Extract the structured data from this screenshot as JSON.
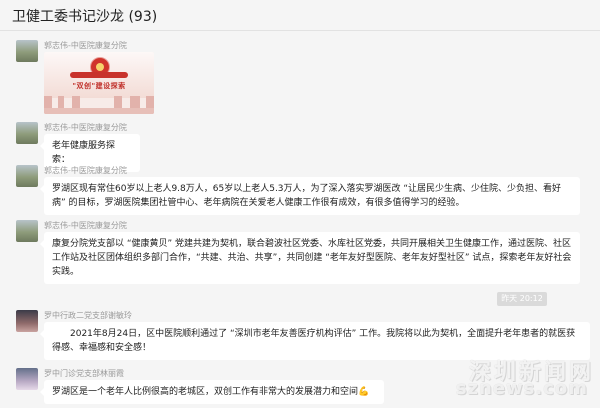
{
  "chat": {
    "title": "卫健工委书记沙龙 (93)"
  },
  "messages": [
    {
      "sender": "郭志伟-中医院康复分院",
      "image_caption": "\"双创\"建设探索"
    },
    {
      "sender": "郭志伟-中医院康复分院",
      "text": "老年健康服务探索："
    },
    {
      "sender": "郭志伟-中医院康复分院",
      "text": "罗湖区现有常住60岁以上老人9.8万人，65岁以上老人5.3万人，为了深入落实罗湖医改 “让居民少生病、少住院、少负担、看好病” 的目标，罗湖医院集团社管中心、老年病院在关爱老人健康工作很有成效，有很多值得学习的经验。"
    },
    {
      "sender": "郭志伟-中医院康复分院",
      "text": "康复分院党支部以 “健康黄贝” 党建共建为契机，联合碧波社区党委、水库社区党委，共同开展相关卫生健康工作，通过医院、社区工作站及社区团体组织多部门合作，“共建、共治、共享”，共同创建 “老年友好型医院、老年友好型社区” 试点，探索老年友好社会实践。"
    },
    {
      "timestamp": "昨天 20:12"
    },
    {
      "sender": "罗中行政二党支部谢敏玲",
      "text": "2021年8月24日，区中医院顺利通过了 “深圳市老年友善医疗机构评估” 工作。我院将以此为契机，全面提升老年患者的就医获得感、幸福感和安全感！"
    },
    {
      "sender": "罗中门诊党支部林丽霞",
      "text": "罗湖区是一个老年人比例很高的老城区，双创工作有非常大的发展潜力和空间",
      "emoji": "💪"
    }
  ],
  "watermark": {
    "cn": "深圳新闻网",
    "en": "sznews.com"
  }
}
